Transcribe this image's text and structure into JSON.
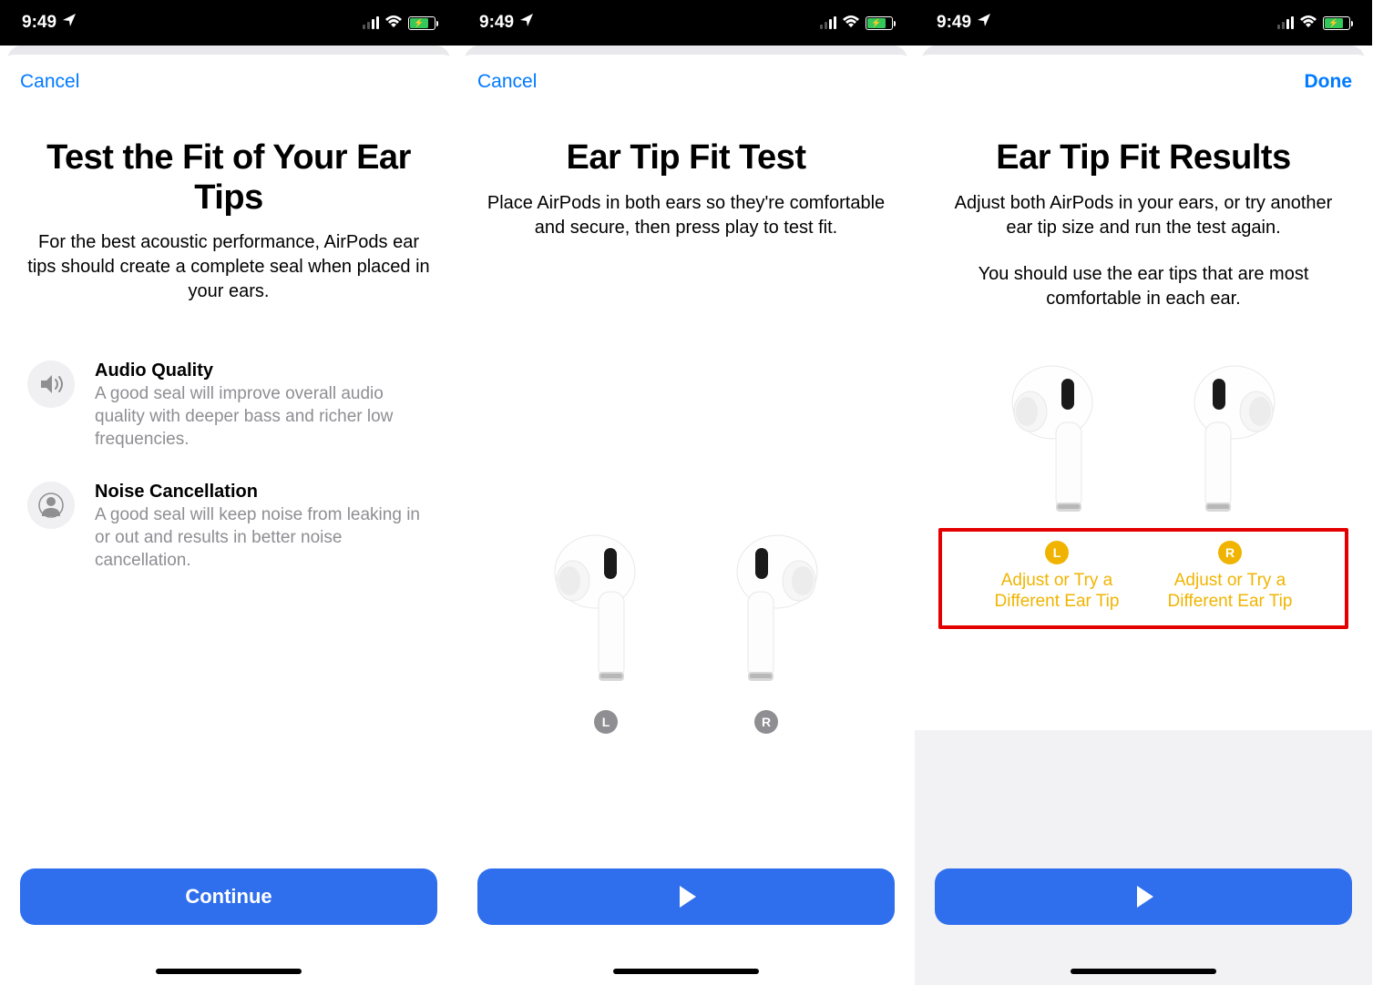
{
  "status": {
    "time": "9:49"
  },
  "screens": [
    {
      "nav_left": "Cancel",
      "title": "Test the Fit of Your Ear Tips",
      "subtitle": "For the best acoustic performance, AirPods ear tips should create a complete seal when placed in your ears.",
      "benefits": [
        {
          "title": "Audio Quality",
          "desc": "A good seal will improve overall audio quality with deeper bass and richer low frequencies."
        },
        {
          "title": "Noise Cancellation",
          "desc": "A good seal will keep noise from leaking in or out and results in better noise cancellation."
        }
      ],
      "button": "Continue"
    },
    {
      "nav_left": "Cancel",
      "title": "Ear Tip Fit Test",
      "subtitle": "Place AirPods in both ears so they're comfortable and secure, then press play to test fit.",
      "left_label": "L",
      "right_label": "R"
    },
    {
      "nav_right": "Done",
      "title": "Ear Tip Fit Results",
      "subtitle1": "Adjust both AirPods in your ears, or try another ear tip size and run the test again.",
      "subtitle2": "You should use the ear tips that are most comfortable in each ear.",
      "left_label": "L",
      "right_label": "R",
      "left_result": "Adjust or Try a Different Ear Tip",
      "right_result": "Adjust or Try a Different Ear Tip"
    }
  ]
}
